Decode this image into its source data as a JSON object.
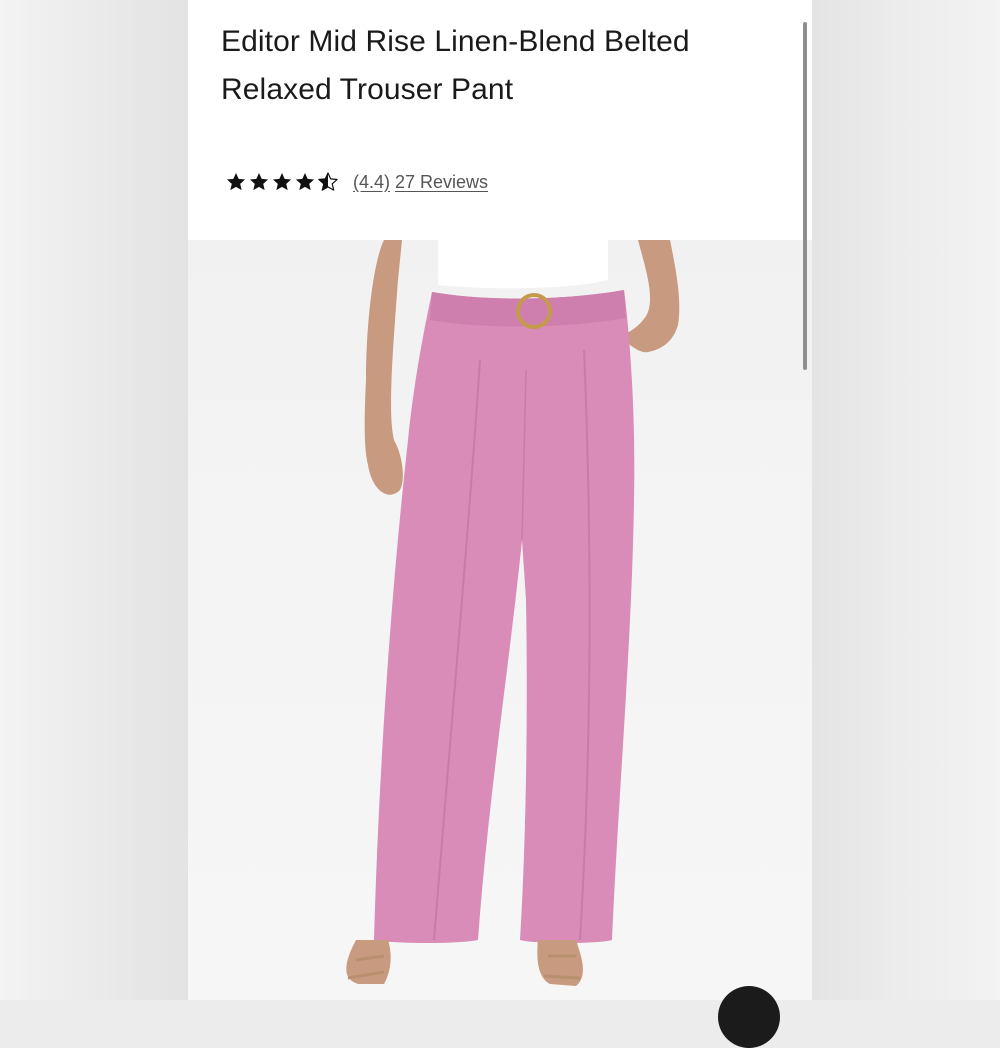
{
  "product": {
    "title_line1": "Editor Mid Rise Linen-Blend Belted",
    "title_line2": "Relaxed Trouser Pant",
    "rating_value": 4.4,
    "rating_text": "(4.4)",
    "review_count_text": "27 Reviews",
    "stars_icon": "star-icon",
    "half_star_icon": "star-half-icon"
  },
  "image": {
    "subject": "pink wide-leg belted trouser pant worn by model",
    "pant_color": "#d98cb8",
    "top_color": "#ffffff",
    "background_color": "#f3f3f3"
  },
  "colors": {
    "text": "#1a1a1a",
    "link": "#555555",
    "star": "#111111",
    "scrollbar": "#8e8e8e"
  }
}
